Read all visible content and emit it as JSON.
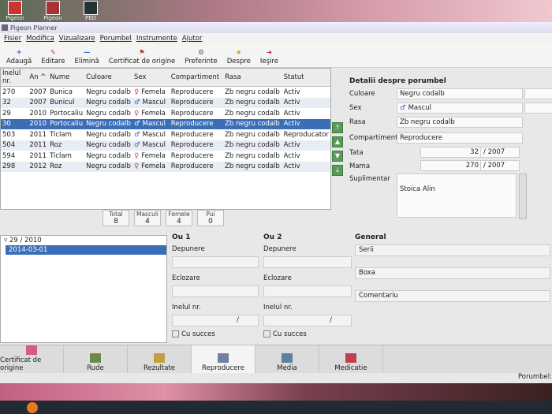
{
  "desktop": {
    "icons": [
      "Pigeon",
      "Pigeon Planner",
      "PED"
    ]
  },
  "window": {
    "title": "Pigeon Planner"
  },
  "menu": [
    "Fisier",
    "Modifica",
    "Vizualizare",
    "Porumbel",
    "Instrumente",
    "Ajutor"
  ],
  "toolbar": [
    {
      "label": "Adaugă",
      "icon": "add-icon",
      "glyph": "+",
      "color": "#2a6ad0"
    },
    {
      "label": "Editare",
      "icon": "edit-icon",
      "glyph": "✎",
      "color": "#b05020"
    },
    {
      "label": "Elimină",
      "icon": "remove-icon",
      "glyph": "—",
      "color": "#2a6ad0"
    },
    {
      "label": "Certificat de origine",
      "icon": "pedigree-icon",
      "glyph": "⚑",
      "color": "#c03030"
    },
    {
      "label": "Preferinte",
      "icon": "preferences-icon",
      "glyph": "⚙",
      "color": "#556"
    },
    {
      "label": "Despre",
      "icon": "about-icon",
      "glyph": "★",
      "color": "#d0a020"
    },
    {
      "label": "Ieşire",
      "icon": "exit-icon",
      "glyph": "➜",
      "color": "#c03030"
    }
  ],
  "table": {
    "columns": [
      "Inelul nr.",
      "An ^",
      "Nume",
      "Culoare",
      "Sex",
      "Compartiment",
      "Rasa",
      "Statut"
    ],
    "rows": [
      [
        "270",
        "2007",
        "Bunica",
        "Negru codalb",
        "Femela",
        "Reproducere",
        "Zb negru codalb",
        "Activ"
      ],
      [
        "32",
        "2007",
        "Bunicul",
        "Negru codalb",
        "Mascul",
        "Reproducere",
        "Zb negru codalb",
        "Activ"
      ],
      [
        "29",
        "2010",
        "Portocaliu",
        "Negru codalb",
        "Femela",
        "Reproducere",
        "Zb negru codalb",
        "Activ"
      ],
      [
        "30",
        "2010",
        "Portocaliu",
        "Negru codalb",
        "Mascul",
        "Reproducere",
        "Zb negru codalb",
        "Activ"
      ],
      [
        "503",
        "2011",
        "Ticlam",
        "Negru codalb",
        "Mascul",
        "Reproducere",
        "Zb negru codalb",
        "Reproducator"
      ],
      [
        "504",
        "2011",
        "Roz",
        "Negru codalb",
        "Mascul",
        "Reproducere",
        "Zb negru codalb",
        "Activ"
      ],
      [
        "594",
        "2011",
        "Ticlam",
        "Negru codalb",
        "Femela",
        "Reproducere",
        "Zb negru codalb",
        "Activ"
      ],
      [
        "298",
        "2012",
        "Roz",
        "Negru codalb",
        "Femela",
        "Reproducere",
        "Zb negru codalb",
        "Activ"
      ]
    ],
    "selected_row": 3
  },
  "counts": [
    {
      "label": "Total",
      "value": "8"
    },
    {
      "label": "Masculi",
      "value": "4"
    },
    {
      "label": "Femele",
      "value": "4"
    },
    {
      "label": "Pui",
      "value": "0"
    }
  ],
  "details": {
    "title": "Detalii despre porumbel",
    "culoare_label": "Culoare",
    "culoare": "Negru codalb",
    "sex_label": "Sex",
    "sex": "Mascul",
    "rasa_label": "Rasa",
    "rasa": "Zb negru codalb",
    "compartiment_label": "Compartiment",
    "compartiment": "Reproducere",
    "tata_label": "Tata",
    "tata_ring": "32",
    "tata_year": "/ 2007",
    "mama_label": "Mama",
    "mama_ring": "270",
    "mama_year": "/ 2007",
    "supl_label": "Suplimentar",
    "supl": "Stoica Alin"
  },
  "tree": {
    "parent": "29 / 2010",
    "child": "2014-03-01"
  },
  "ou1": {
    "title": "Ou 1",
    "depunere": "Depunere",
    "eclozare": "Eclozare",
    "inel": "Inelul nr.",
    "slash": "/",
    "succes": "Cu succes"
  },
  "ou2": {
    "title": "Ou 2",
    "depunere": "Depunere",
    "eclozare": "Eclozare",
    "inel": "Inelul nr.",
    "slash": "/",
    "succes": "Cu succes"
  },
  "general": {
    "title": "General",
    "serii": "Serii",
    "boxa": "Boxa",
    "comentariu": "Comentariu"
  },
  "tabs": [
    {
      "label": "Certificat de origine",
      "icon": "pedigree-tab-icon",
      "color": "#d06080"
    },
    {
      "label": "Rude",
      "icon": "relatives-icon",
      "color": "#6a8a4a"
    },
    {
      "label": "Rezultate",
      "icon": "results-icon",
      "color": "#c0a040"
    },
    {
      "label": "Reproducere",
      "icon": "breeding-icon",
      "color": "#7080a0"
    },
    {
      "label": "Media",
      "icon": "media-icon",
      "color": "#6080a0"
    },
    {
      "label": "Medicatie",
      "icon": "medication-icon",
      "color": "#c04050"
    }
  ],
  "active_tab": 3,
  "status": {
    "label": "Porumbel:"
  }
}
